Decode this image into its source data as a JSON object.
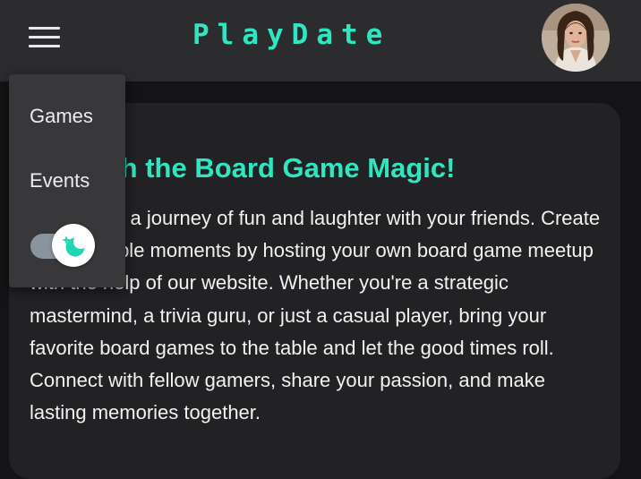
{
  "header": {
    "menu_icon": "hamburger-icon",
    "brand": "PlayDate",
    "avatar_icon": "user-avatar"
  },
  "menu": {
    "items": [
      {
        "label": "Games"
      },
      {
        "label": "Events"
      }
    ],
    "theme_toggle_icon": "moon-sparkle-icon"
  },
  "hero": {
    "title": "Unleash the Board Game Magic!",
    "body": "Embark on a journey of fun and laughter with your friends. Create unforgettable moments by hosting your own board game meetup with the help of our website. Whether you're a strategic mastermind, a trivia guru, or just a casual player, bring your favorite board games to the table and let the good times roll. Connect with fellow gamers, share your passion, and make lasting memories together."
  },
  "colors": {
    "accent": "#2ee6c0",
    "header_bg": "#2c2c2f",
    "page_bg": "#141416",
    "card_bg": "#222124",
    "menu_bg": "#38383b"
  }
}
